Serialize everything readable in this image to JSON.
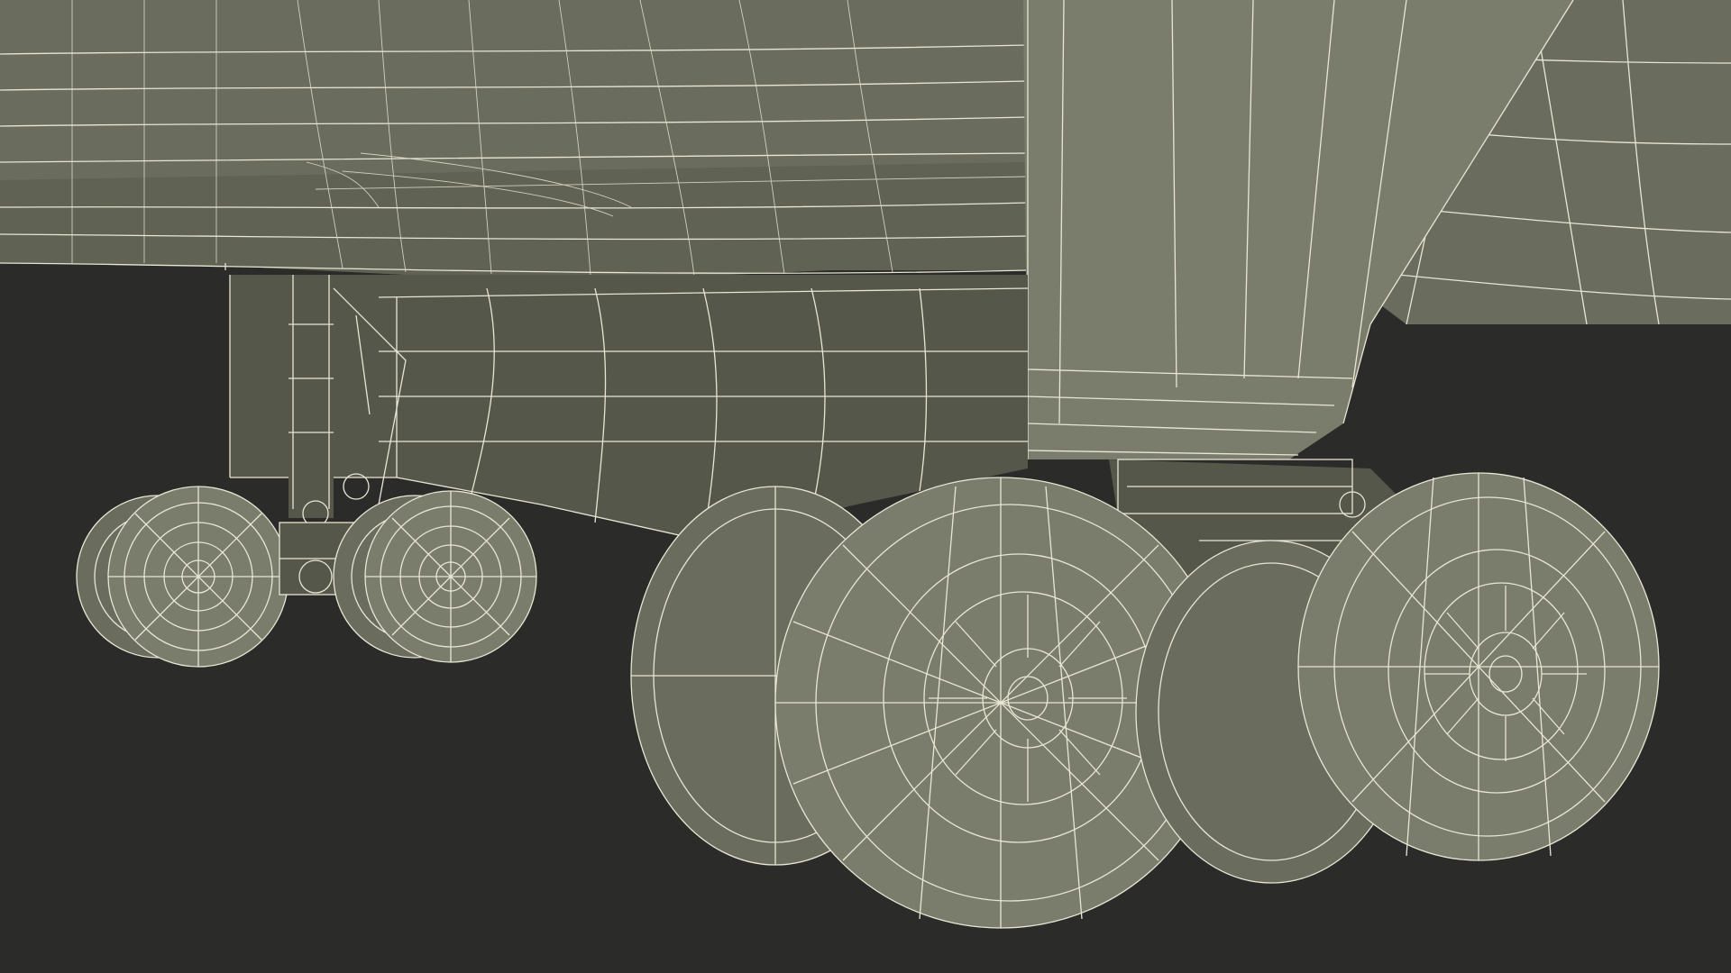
{
  "colors": {
    "background": "#2b2b2a",
    "surface": "#6a6c5d",
    "surface_shadow": "#55574a",
    "surface_highlight": "#7b7d6c",
    "wireframe": "#e9e6d4"
  },
  "icons": [
    "aircraft-fuselage",
    "wing-pylon",
    "nose-landing-gear",
    "main-landing-gear"
  ]
}
